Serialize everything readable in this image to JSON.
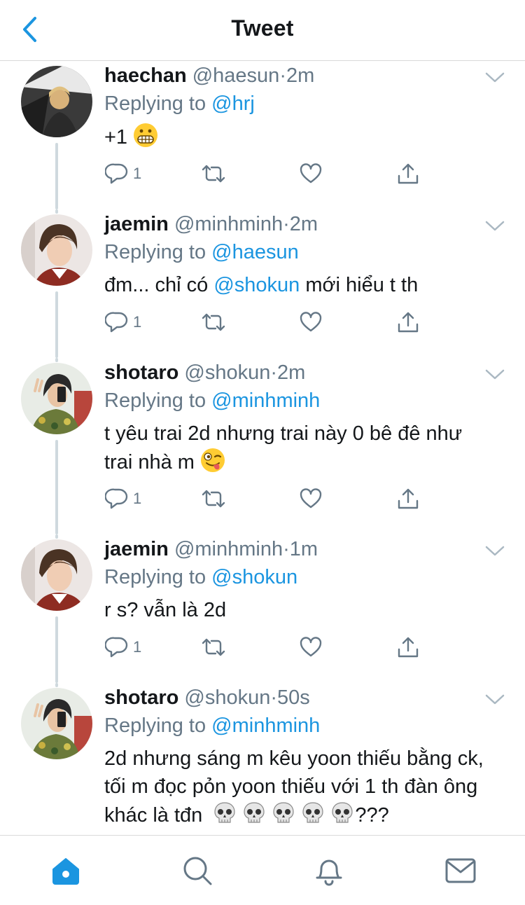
{
  "header": {
    "title": "Tweet",
    "back_icon": "chevron-left-icon"
  },
  "colors": {
    "accent": "#1b95e0",
    "text": "#14171a",
    "muted": "#657786",
    "thread": "#cfd9de"
  },
  "tweets": [
    {
      "name": "haechan",
      "handle": "@haesun",
      "dot": "·",
      "time": "2m",
      "reply_prefix": "Replying to",
      "reply_to": "@hrj",
      "body": {
        "text": "+1",
        "emoji": [
          "grimacing-face"
        ]
      },
      "reply_count": "1"
    },
    {
      "name": "jaemin",
      "handle": "@minhminh",
      "dot": "·",
      "time": "2m",
      "reply_prefix": "Replying to",
      "reply_to": "@haesun",
      "body": {
        "pre": "đm... chỉ có ",
        "mention": "@shokun",
        "post": " mới hiểu t th"
      },
      "reply_count": "1"
    },
    {
      "name": "shotaro",
      "handle": "@shokun",
      "dot": "·",
      "time": "2m",
      "reply_prefix": "Replying to",
      "reply_to": "@minhminh",
      "body": {
        "line1": "t yêu trai 2d nhưng trai này 0 bê đê như",
        "line2": "trai nhà m",
        "emoji": [
          "winking-face-with-tongue"
        ]
      },
      "reply_count": "1"
    },
    {
      "name": "jaemin",
      "handle": "@minhminh",
      "dot": "·",
      "time": "1m",
      "reply_prefix": "Replying to",
      "reply_to": "@shokun",
      "body": {
        "text": "r s? vẫn là 2d"
      },
      "reply_count": "1"
    },
    {
      "name": "shotaro",
      "handle": "@shokun",
      "dot": "·",
      "time": "50s",
      "reply_prefix": "Replying to",
      "reply_to": "@minhminh",
      "body": {
        "line1": "2d nhưng sáng m kêu yoon thiếu bằng ck,",
        "line2": "tối m đọc pỏn yoon thiếu với 1 th đàn ông",
        "line3": "khác là tđn",
        "tail": "???",
        "emoji": [
          "skull",
          "skull",
          "skull",
          "skull",
          "skull"
        ]
      }
    }
  ],
  "tabbar": {
    "items": [
      "home-icon",
      "search-icon",
      "notifications-bell-icon",
      "messages-envelope-icon"
    ],
    "active": "home-icon"
  }
}
